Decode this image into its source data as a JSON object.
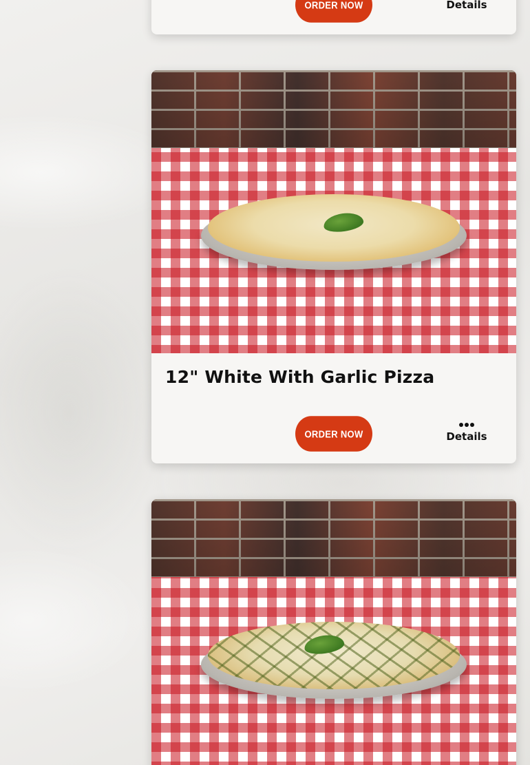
{
  "products": [
    {
      "title": "",
      "order_label": "ORDER NOW",
      "details_label": "Details"
    },
    {
      "title": "12\" White With Garlic Pizza",
      "order_label": "ORDER NOW",
      "details_label": "Details"
    },
    {
      "title": "",
      "order_label": "",
      "details_label": ""
    }
  ],
  "icons": {
    "details": "more-horizontal-icon"
  },
  "colors": {
    "order_button": "#d53a14",
    "card_background": "#f7f6f4",
    "tablecloth_red": "#c8141e"
  }
}
